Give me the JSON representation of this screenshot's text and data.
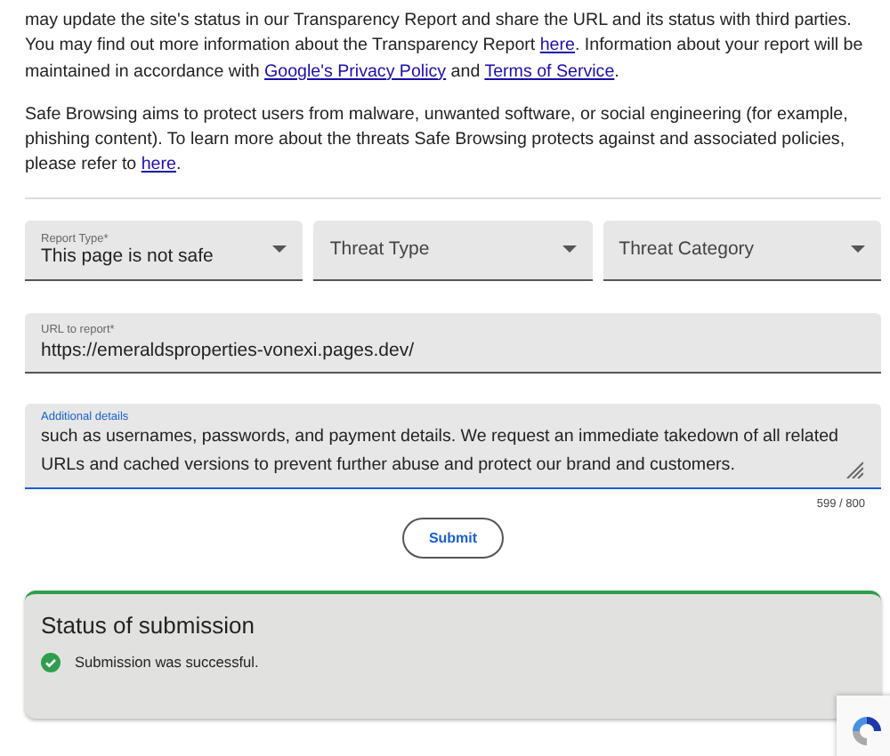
{
  "paragraphs": [
    [
      {
        "kind": "text",
        "text": "may update the site's status in our Transparency Report and share the URL and its status with third parties. You may find out more information about the Transparency Report "
      },
      {
        "kind": "link",
        "text": "here"
      },
      {
        "kind": "text",
        "text": ". Information about your report will be maintained in accordance with "
      },
      {
        "kind": "link",
        "text": "Google's Privacy Policy"
      },
      {
        "kind": "text",
        "text": " and "
      },
      {
        "kind": "link",
        "text": "Terms of Service"
      },
      {
        "kind": "text",
        "text": "."
      }
    ],
    [
      {
        "kind": "text",
        "text": "Safe Browsing aims to protect users from malware, unwanted software, or social engineering (for example, phishing content). To learn more about the threats Safe Browsing protects against and associated policies, please refer to "
      },
      {
        "kind": "link",
        "text": "here"
      },
      {
        "kind": "text",
        "text": "."
      }
    ]
  ],
  "dropdowns": [
    {
      "label": "Report Type*",
      "value": "This page is not safe"
    },
    {
      "placeholder": "Threat Type"
    },
    {
      "placeholder": "Threat Category"
    }
  ],
  "url_field": {
    "label": "URL to report*",
    "value": "https://emeraldsproperties-vonexi.pages.dev/"
  },
  "details_field": {
    "label": "Additional details",
    "value": "such as usernames, passwords, and payment details. We request an immediate takedown of all related URLs and cached versions to prevent further abuse and protect our brand and customers.",
    "counter": "599 / 800"
  },
  "submit_button": "Submit",
  "status": {
    "title": "Status of submission",
    "message": "Submission was successful.",
    "kind": "success"
  }
}
